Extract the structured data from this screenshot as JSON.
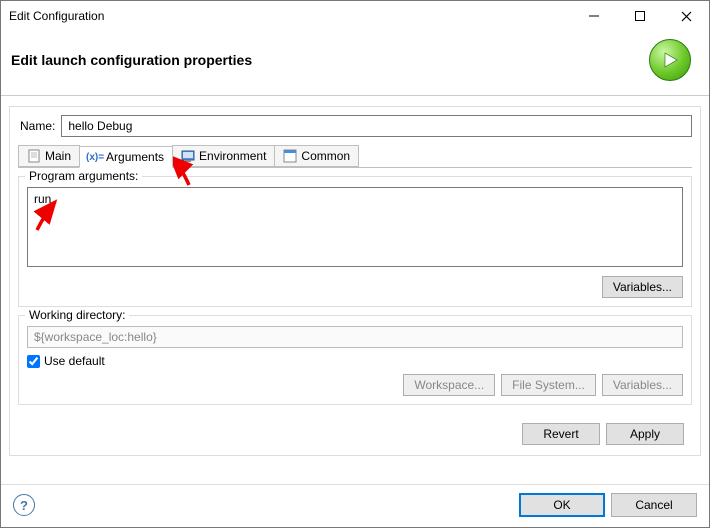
{
  "window": {
    "title": "Edit Configuration"
  },
  "header": {
    "heading": "Edit launch configuration properties"
  },
  "form": {
    "name_label": "Name:",
    "name_value": "hello Debug"
  },
  "tabs": [
    {
      "label": "Main",
      "active": false
    },
    {
      "label": "Arguments",
      "active": true
    },
    {
      "label": "Environment",
      "active": false
    },
    {
      "label": "Common",
      "active": false
    }
  ],
  "arguments": {
    "program_label": "Program arguments:",
    "program_value": "run",
    "variables_button": "Variables...",
    "working_dir_label": "Working directory:",
    "working_dir_value": "${workspace_loc:hello}",
    "use_default_label": "Use default",
    "use_default_checked": true,
    "workspace_button": "Workspace...",
    "filesystem_button": "File System...",
    "variables_button2": "Variables..."
  },
  "buttons": {
    "revert": "Revert",
    "apply": "Apply",
    "ok": "OK",
    "cancel": "Cancel"
  }
}
